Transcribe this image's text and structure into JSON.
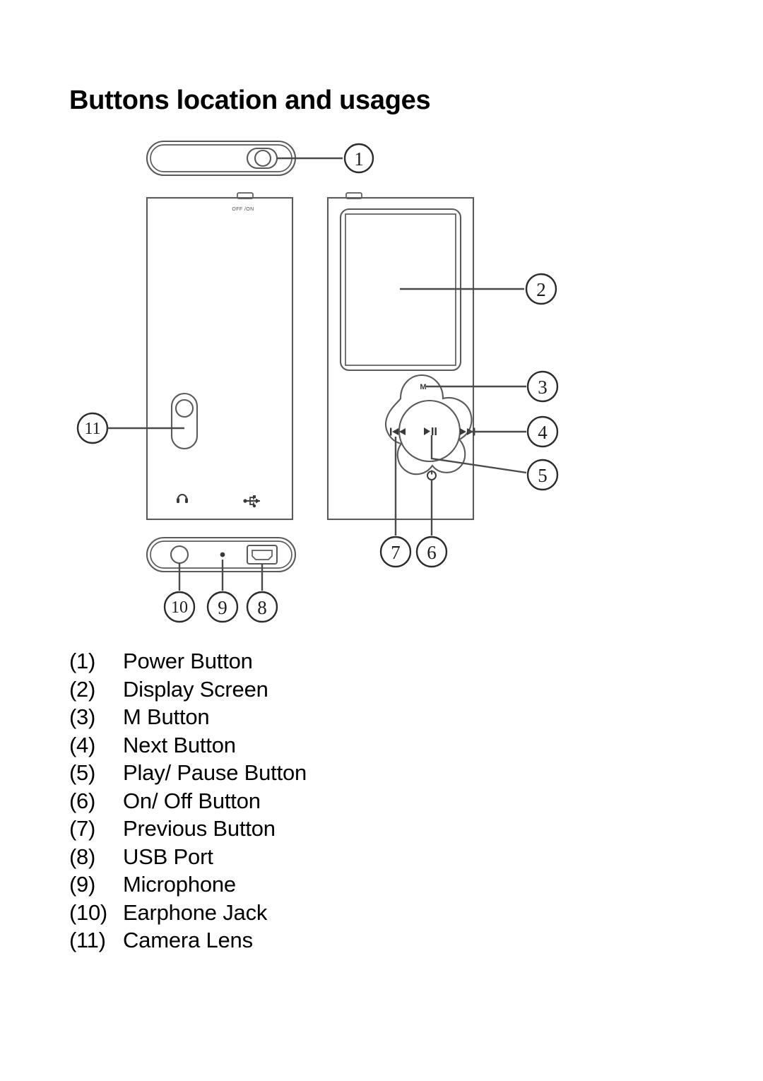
{
  "document": {
    "title": "Buttons location and usages"
  },
  "figure": {
    "name": "buttons-location-diagram",
    "views": {
      "top": {
        "name": "top-view",
        "switch_label": "OFF/ON"
      },
      "back": {
        "name": "back-view",
        "switch_label": "OFF/ON",
        "icons": [
          "earphone-icon",
          "usb-icon"
        ]
      },
      "front": {
        "name": "front-view",
        "pad_labels": {
          "top": "M",
          "left": "◀◀",
          "right": "▶▶",
          "center": "▶‖",
          "bottom": "⏻"
        }
      },
      "bottom": {
        "name": "bottom-view"
      }
    },
    "callouts": [
      {
        "id": "1",
        "target": "power-button",
        "view": "top"
      },
      {
        "id": "2",
        "target": "display-screen",
        "view": "front"
      },
      {
        "id": "3",
        "target": "m-button",
        "view": "front"
      },
      {
        "id": "4",
        "target": "next-button",
        "view": "front"
      },
      {
        "id": "5",
        "target": "play-pause-button",
        "view": "front"
      },
      {
        "id": "6",
        "target": "on-off-button",
        "view": "front"
      },
      {
        "id": "7",
        "target": "previous-button",
        "view": "front"
      },
      {
        "id": "8",
        "target": "usb-port",
        "view": "bottom"
      },
      {
        "id": "9",
        "target": "microphone",
        "view": "bottom"
      },
      {
        "id": "10",
        "target": "earphone-jack",
        "view": "bottom"
      },
      {
        "id": "11",
        "target": "camera-lens",
        "view": "back"
      }
    ]
  },
  "legend": {
    "items": [
      {
        "num": "(1)",
        "label": "Power Button"
      },
      {
        "num": "(2)",
        "label": "Display Screen"
      },
      {
        "num": "(3)",
        "label": "M Button"
      },
      {
        "num": "(4)",
        "label": "Next Button"
      },
      {
        "num": "(5)",
        "label": "Play/ Pause Button"
      },
      {
        "num": "(6)",
        "label": "On/ Off Button"
      },
      {
        "num": "(7)",
        "label": "Previous Button"
      },
      {
        "num": "(8)",
        "label": "USB Port"
      },
      {
        "num": "(9)",
        "label": "Microphone"
      },
      {
        "num": "(10)",
        "label": "Earphone Jack"
      },
      {
        "num": "(11)",
        "label": "Camera Lens"
      }
    ]
  },
  "colors": {
    "ink": "#1a1a1a",
    "line": "#555555",
    "paper": "#ffffff"
  }
}
